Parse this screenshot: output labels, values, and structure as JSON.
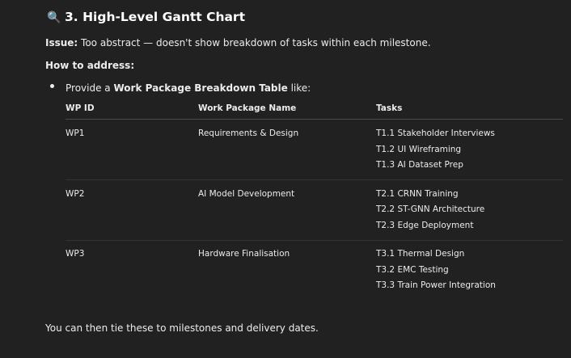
{
  "heading": {
    "icon": "magnifier-icon",
    "text": "3. High-Level Gantt Chart"
  },
  "issue": {
    "label": "Issue:",
    "text": " Too abstract — doesn't show breakdown of tasks within each milestone."
  },
  "how": "How to address:",
  "bullet": {
    "pre": "Provide a ",
    "bold": "Work Package Breakdown Table",
    "post": " like:"
  },
  "table": {
    "headers": [
      "WP ID",
      "Work Package Name",
      "Tasks"
    ],
    "rows": [
      {
        "id": "WP1",
        "name": "Requirements & Design",
        "tasks": [
          "T1.1 Stakeholder Interviews",
          "T1.2 UI Wireframing",
          "T1.3 AI Dataset Prep"
        ]
      },
      {
        "id": "WP2",
        "name": "AI Model Development",
        "tasks": [
          "T2.1 CRNN Training",
          "T2.2 ST-GNN Architecture",
          "T2.3 Edge Deployment"
        ]
      },
      {
        "id": "WP3",
        "name": "Hardware Finalisation",
        "tasks": [
          "T3.1 Thermal Design",
          "T3.2 EMC Testing",
          "T3.3 Train Power Integration"
        ]
      }
    ]
  },
  "footer": "You can then tie these to milestones and delivery dates."
}
